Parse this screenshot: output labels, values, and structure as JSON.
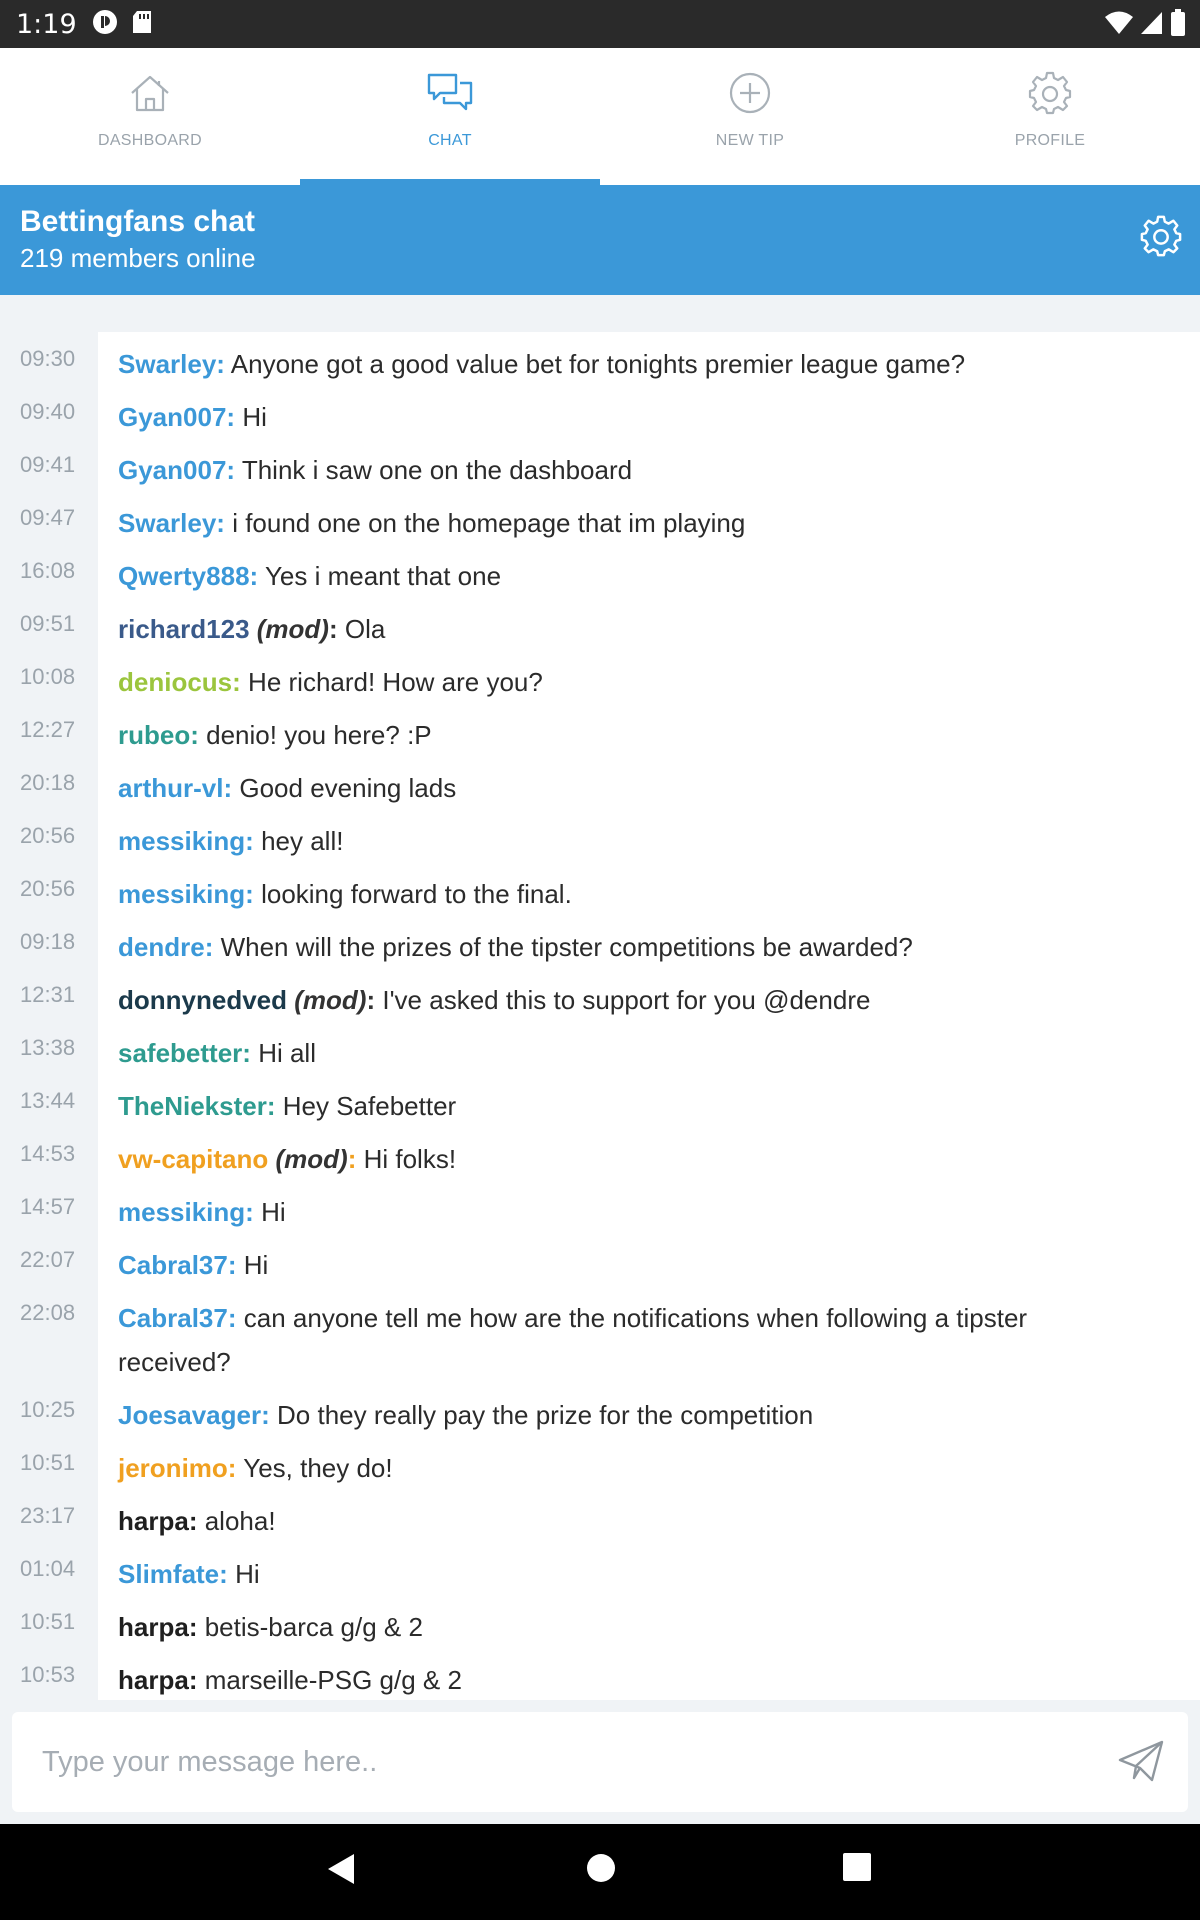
{
  "statusbar": {
    "time": "1:19"
  },
  "tabs": [
    {
      "label": "DASHBOARD",
      "icon": "home-icon",
      "active": false
    },
    {
      "label": "CHAT",
      "icon": "chat-icon",
      "active": true
    },
    {
      "label": "NEW TIP",
      "icon": "plus-circle-icon",
      "active": false
    },
    {
      "label": "PROFILE",
      "icon": "gear-icon",
      "active": false
    }
  ],
  "header": {
    "title": "Bettingfans chat",
    "subtitle": "219 members online"
  },
  "colors": {
    "accent": "#3b98d8",
    "user_blue": "#3b98d8",
    "user_navy": "#3a5a8a",
    "user_dark": "#1b3a4b",
    "user_green": "#9bc53d",
    "user_teal": "#2e9b8f",
    "user_orange": "#f0a020",
    "user_black": "#1f1f1f"
  },
  "messages": [
    {
      "time": "09:30",
      "user": "Swarley",
      "color": "user_blue",
      "mod": false,
      "text": "Anyone got a good value bet for tonights premier league  game?"
    },
    {
      "time": "09:40",
      "user": "Gyan007",
      "color": "user_blue",
      "mod": false,
      "text": "Hi"
    },
    {
      "time": "09:41",
      "user": "Gyan007",
      "color": "user_blue",
      "mod": false,
      "text": "Think i saw one on the dashboard"
    },
    {
      "time": "09:47",
      "user": "Swarley",
      "color": "user_blue",
      "mod": false,
      "text": "i found one on the homepage that im playing"
    },
    {
      "time": "16:08",
      "user": "Qwerty888",
      "color": "user_blue",
      "mod": false,
      "text": "Yes i meant that one"
    },
    {
      "time": "09:51",
      "user": "richard123",
      "color": "user_navy",
      "mod": true,
      "text": "Ola"
    },
    {
      "time": "10:08",
      "user": "deniocus",
      "color": "user_green",
      "mod": false,
      "text": "He richard! How are you?"
    },
    {
      "time": "12:27",
      "user": "rubeo",
      "color": "user_teal",
      "mod": false,
      "text": "denio! you here? :P"
    },
    {
      "time": "20:18",
      "user": "arthur-vl",
      "color": "user_blue",
      "mod": false,
      "text": "Good evening lads"
    },
    {
      "time": "20:56",
      "user": "messiking",
      "color": "user_blue",
      "mod": false,
      "text": "hey all!"
    },
    {
      "time": "20:56",
      "user": "messiking",
      "color": "user_blue",
      "mod": false,
      "text": "looking forward to the final."
    },
    {
      "time": "09:18",
      "user": "dendre",
      "color": "user_blue",
      "mod": false,
      "text": "When will the prizes of the tipster competitions be awarded?"
    },
    {
      "time": "12:31",
      "user": "donnynedved",
      "color": "user_dark",
      "mod": true,
      "text": "I've asked this to support for you @dendre"
    },
    {
      "time": "13:38",
      "user": "safebetter",
      "color": "user_teal",
      "mod": false,
      "text": "Hi all"
    },
    {
      "time": "13:44",
      "user": "TheNiekster",
      "color": "user_teal",
      "mod": false,
      "text": "Hey Safebetter"
    },
    {
      "time": "14:53",
      "user": "vw-capitano",
      "color": "user_orange",
      "mod": true,
      "text": "Hi folks!"
    },
    {
      "time": "14:57",
      "user": "messiking",
      "color": "user_blue",
      "mod": false,
      "text": "Hi"
    },
    {
      "time": "22:07",
      "user": "Cabral37",
      "color": "user_blue",
      "mod": false,
      "text": "Hi"
    },
    {
      "time": "22:08",
      "user": "Cabral37",
      "color": "user_blue",
      "mod": false,
      "text": "can anyone tell me how are the notifications when following a tipster received?"
    },
    {
      "time": "10:25",
      "user": "Joesavager",
      "color": "user_blue",
      "mod": false,
      "text": "Do they  really pay the prize for the competition"
    },
    {
      "time": "10:51",
      "user": "jeronimo",
      "color": "user_orange",
      "mod": false,
      "text": "Yes, they do!"
    },
    {
      "time": "23:17",
      "user": "harpa",
      "color": "user_black",
      "mod": false,
      "text": "aloha!"
    },
    {
      "time": "01:04",
      "user": "Slimfate",
      "color": "user_blue",
      "mod": false,
      "text": "Hi"
    },
    {
      "time": "10:51",
      "user": "harpa",
      "color": "user_black",
      "mod": false,
      "text": "betis-barca g/g & 2"
    },
    {
      "time": "10:53",
      "user": "harpa",
      "color": "user_black",
      "mod": false,
      "text": "marseille-PSG g/g & 2"
    }
  ],
  "mod_label": "(mod)",
  "composer": {
    "placeholder": "Type your message here.."
  }
}
